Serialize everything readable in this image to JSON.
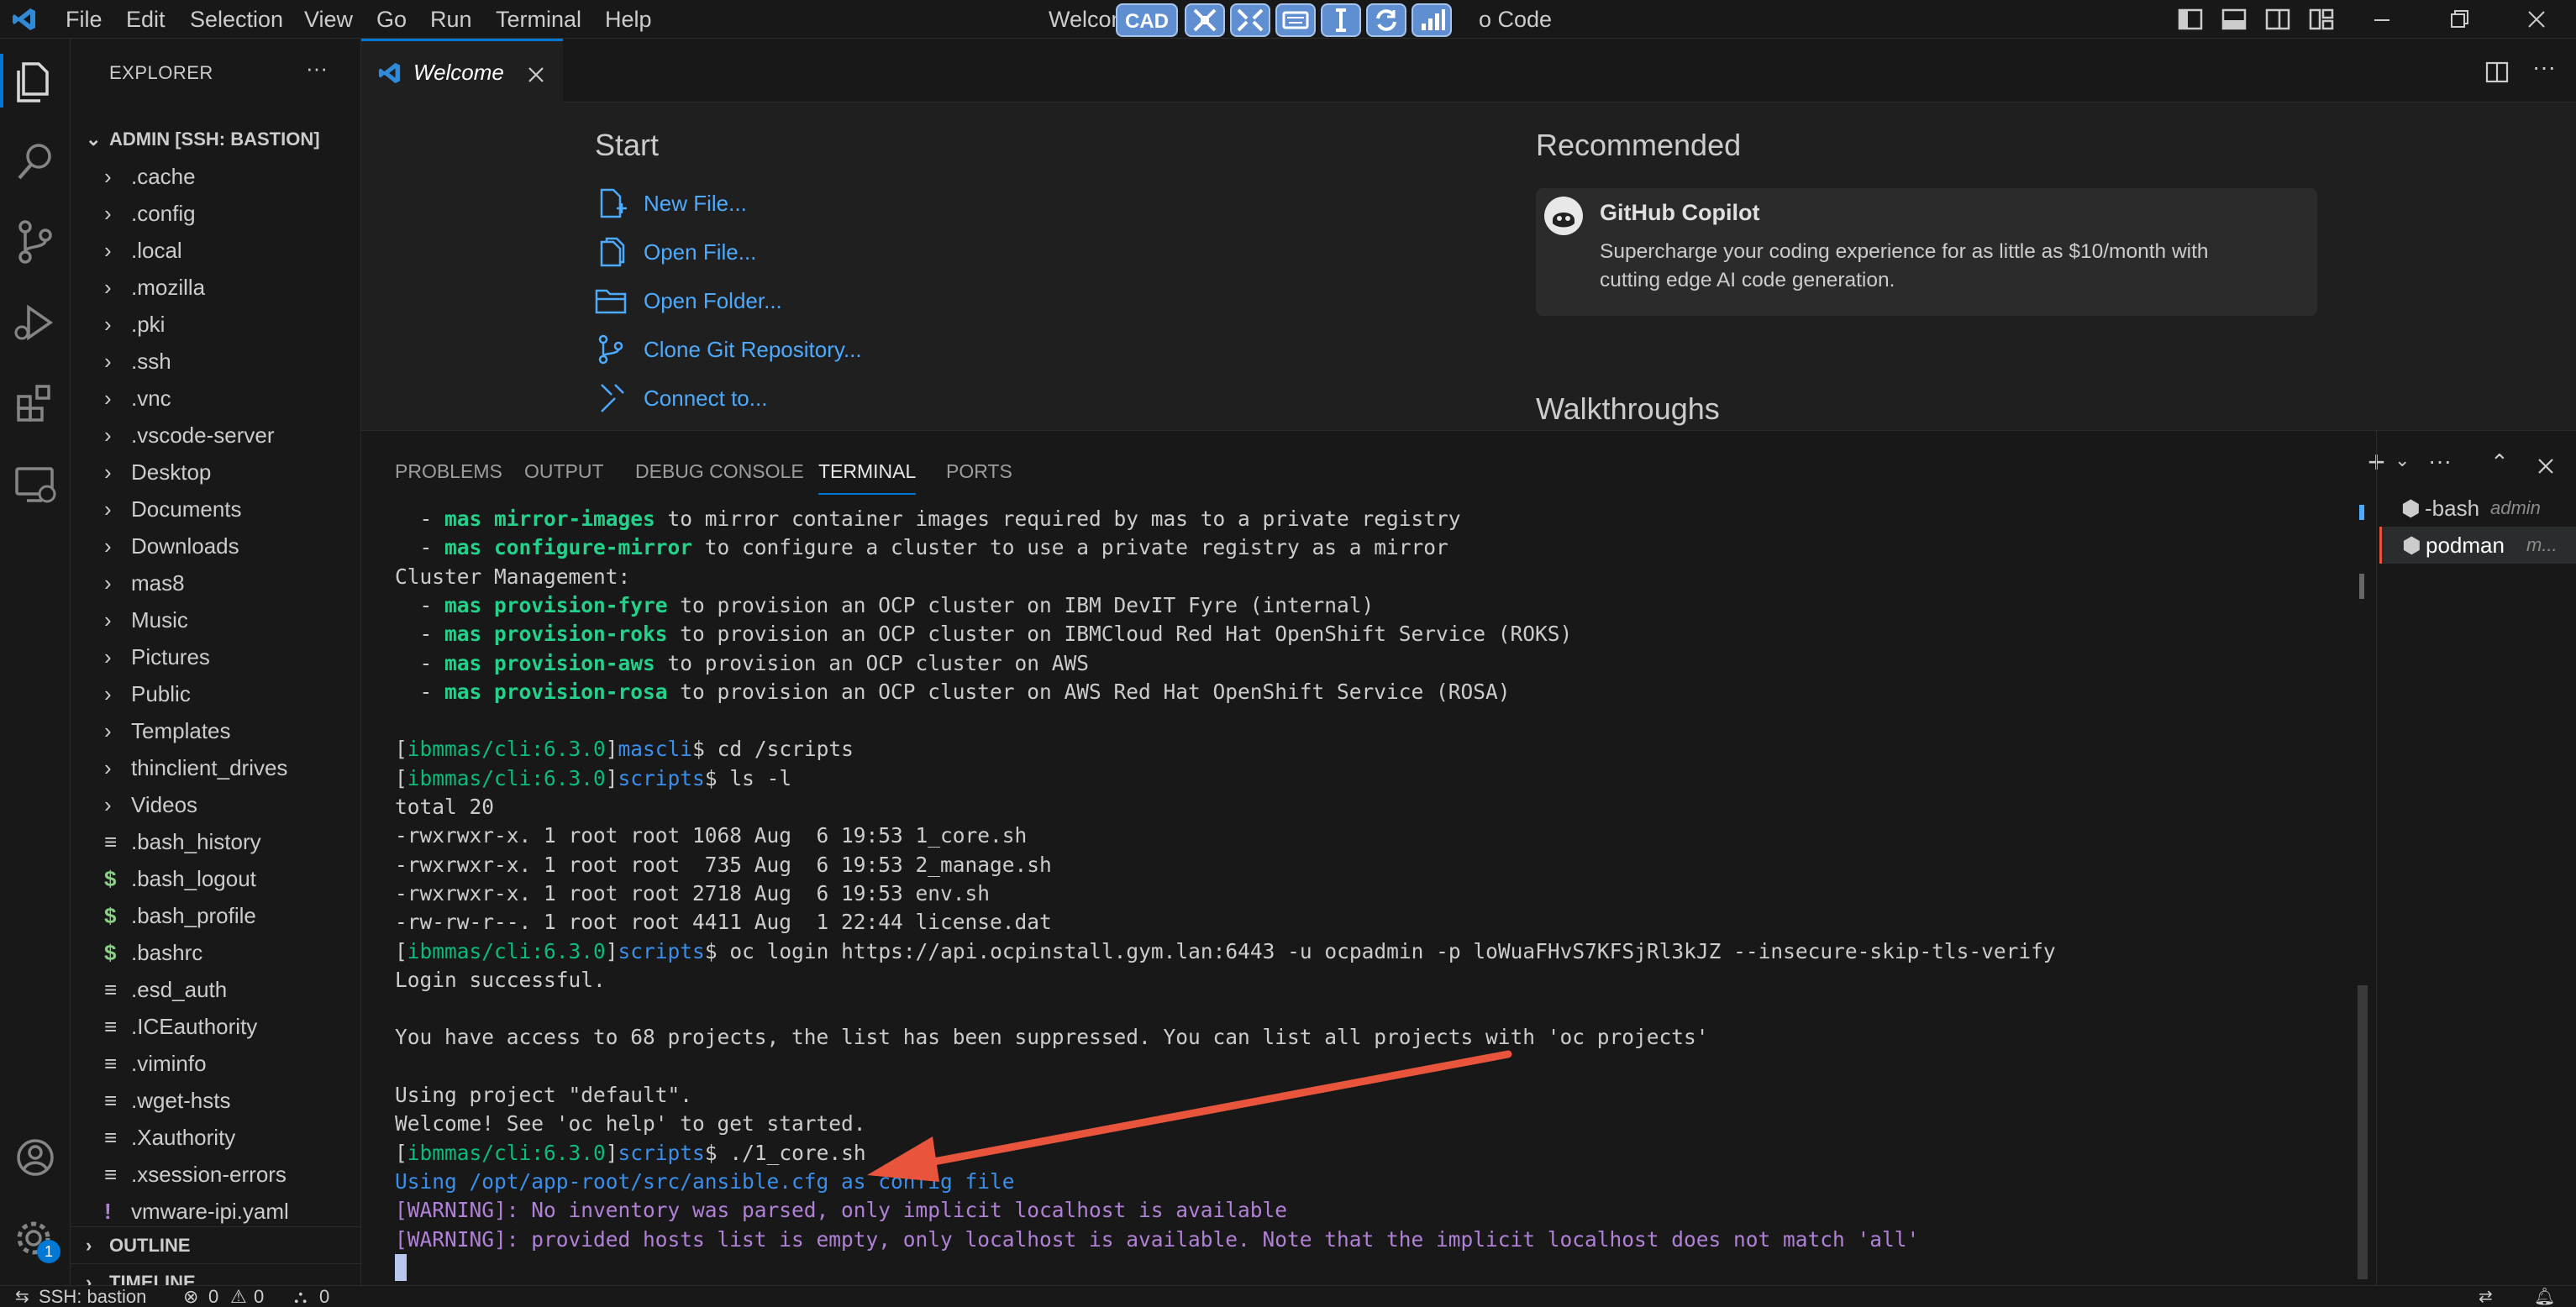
{
  "title_bar": {
    "menu": [
      "File",
      "Edit",
      "Selection",
      "View",
      "Go",
      "Run",
      "Terminal",
      "Help"
    ],
    "window_title_left": "Welcom",
    "window_title_right": "o Code",
    "remote_toolbar": {
      "cad_label": "CAD",
      "handle_glyph": "^"
    }
  },
  "activity_bar": {
    "accounts_badge": "1"
  },
  "sidebar": {
    "title": "EXPLORER",
    "more_icon": "···",
    "root": "ADMIN [SSH: BASTION]",
    "folders": [
      ".cache",
      ".config",
      ".local",
      ".mozilla",
      ".pki",
      ".ssh",
      ".vnc",
      ".vscode-server",
      "Desktop",
      "Documents",
      "Downloads",
      "mas8",
      "Music",
      "Pictures",
      "Public",
      "Templates",
      "thinclient_drives",
      "Videos"
    ],
    "files": [
      {
        "name": ".bash_history",
        "icon": "≡"
      },
      {
        "name": ".bash_logout",
        "icon": "$"
      },
      {
        "name": ".bash_profile",
        "icon": "$"
      },
      {
        "name": ".bashrc",
        "icon": "$"
      },
      {
        "name": ".esd_auth",
        "icon": "≡"
      },
      {
        "name": ".ICEauthority",
        "icon": "≡"
      },
      {
        "name": ".viminfo",
        "icon": "≡"
      },
      {
        "name": ".wget-hsts",
        "icon": "≡"
      },
      {
        "name": ".Xauthority",
        "icon": "≡"
      },
      {
        "name": ".xsession-errors",
        "icon": "≡"
      },
      {
        "name": "vmware-ipi.yaml",
        "icon": "!"
      }
    ],
    "outline": "OUTLINE",
    "timeline": "TIMELINE"
  },
  "editor": {
    "tab_label": "Welcome",
    "start_heading": "Start",
    "start_links": [
      "New File...",
      "Open File...",
      "Open Folder...",
      "Clone Git Repository...",
      "Connect to..."
    ],
    "recommended_heading": "Recommended",
    "copilot_title": "GitHub Copilot",
    "copilot_desc_1": "Supercharge your coding experience for as little as $10/month with",
    "copilot_desc_2": "cutting edge AI code generation.",
    "walkthroughs_heading": "Walkthroughs"
  },
  "panel": {
    "tabs": [
      "PROBLEMS",
      "OUTPUT",
      "DEBUG CONSOLE",
      "TERMINAL",
      "PORTS"
    ],
    "active_tab": "TERMINAL",
    "terminals": [
      {
        "name": "-bash",
        "desc": "admin"
      },
      {
        "name": "podman",
        "desc": "m..."
      }
    ]
  },
  "terminal": {
    "prompt_image": "ibmmas/cli:6.3.0",
    "lines": [
      {
        "pre": "  - ",
        "cmd": "mas mirror-images",
        "post": " to mirror container images required by mas to a private registry"
      },
      {
        "pre": "  - ",
        "cmd": "mas configure-mirror",
        "post": " to configure a cluster to use a private registry as a mirror"
      },
      {
        "text": "Cluster Management:"
      },
      {
        "pre": "  - ",
        "cmd": "mas provision-fyre",
        "post": " to provision an OCP cluster on IBM DevIT Fyre (internal)"
      },
      {
        "pre": "  - ",
        "cmd": "mas provision-roks",
        "post": " to provision an OCP cluster on IBMCloud Red Hat OpenShift Service (ROKS)"
      },
      {
        "pre": "  - ",
        "cmd": "mas provision-aws",
        "post": " to provision an OCP cluster on AWS"
      },
      {
        "pre": "  - ",
        "cmd": "mas provision-rosa",
        "post": " to provision an OCP cluster on AWS Red Hat OpenShift Service (ROSA)"
      },
      {
        "text": ""
      },
      {
        "dir": "mascli",
        "cmdline": "$ cd /scripts"
      },
      {
        "dir": "scripts",
        "cmdline": "$ ls -l"
      },
      {
        "text": "total 20"
      },
      {
        "text": "-rwxrwxr-x. 1 root root 1068 Aug  6 19:53 1_core.sh"
      },
      {
        "text": "-rwxrwxr-x. 1 root root  735 Aug  6 19:53 2_manage.sh"
      },
      {
        "text": "-rwxrwxr-x. 1 root root 2718 Aug  6 19:53 env.sh"
      },
      {
        "text": "-rw-rw-r--. 1 root root 4411 Aug  1 22:44 license.dat"
      },
      {
        "dir": "scripts",
        "cmdline": "$ oc login https://api.ocpinstall.gym.lan:6443 -u ocpadmin -p loWuaFHvS7KFSjRl3kJZ --insecure-skip-tls-verify"
      },
      {
        "text": "Login successful."
      },
      {
        "text": ""
      },
      {
        "text": "You have access to 68 projects, the list has been suppressed. You can list all projects with 'oc projects'"
      },
      {
        "text": ""
      },
      {
        "text": "Using project \"default\"."
      },
      {
        "text": "Welcome! See 'oc help' to get started."
      },
      {
        "dir": "scripts",
        "cmdline": "$ ./1_core.sh"
      },
      {
        "blue": "Using /opt/app-root/src/ansible.cfg as config file"
      },
      {
        "warn": "[WARNING]: No inventory was parsed, only implicit localhost is available"
      },
      {
        "warn": "[WARNING]: provided hosts list is empty, only localhost is available. Note that the implicit localhost does not match 'all'"
      }
    ]
  },
  "status_bar": {
    "remote": "SSH: bastion",
    "errors": "0",
    "warnings": "0",
    "ports": "0"
  },
  "colors": {
    "accent": "#0078d4",
    "link": "#4daafc",
    "arrow": "#e8553c"
  }
}
